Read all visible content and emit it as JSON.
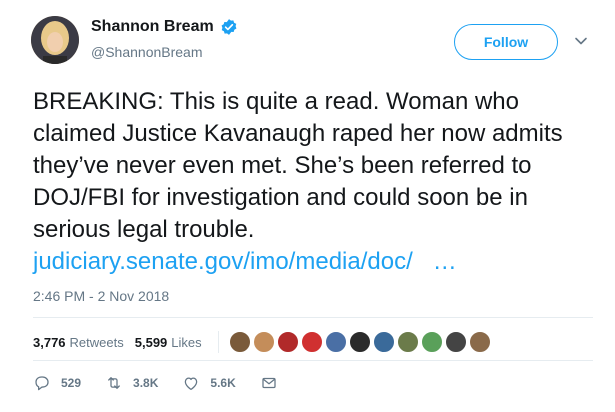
{
  "author": {
    "name": "Shannon Bream",
    "handle": "@ShannonBream",
    "verified": true
  },
  "follow_label": "Follow",
  "tweet": {
    "text": "BREAKING:  This is quite a read. Woman who claimed Justice Kavanaugh raped her now admits they’ve never even met. She’s been referred to DOJ/FBI for investigation and could soon be in serious legal trouble. ",
    "link": "judiciary.senate.gov/imo/media/doc/",
    "ellipsis": "…",
    "timestamp": "2:46 PM - 2 Nov 2018"
  },
  "stats": {
    "retweets_count": "3,776",
    "retweets_label": "Retweets",
    "likes_count": "5,599",
    "likes_label": "Likes"
  },
  "liker_avatar_colors": [
    "#7a5a3a",
    "#c48d5a",
    "#b12a2a",
    "#d03030",
    "#4a6fa5",
    "#2b2b2b",
    "#3a6a9a",
    "#6b7b4a",
    "#5aa05a",
    "#444444",
    "#8a6a4a"
  ],
  "actions": {
    "replies": "529",
    "retweets": "3.8K",
    "likes": "5.6K"
  },
  "colors": {
    "accent": "#1da1f2",
    "muted": "#657786"
  }
}
